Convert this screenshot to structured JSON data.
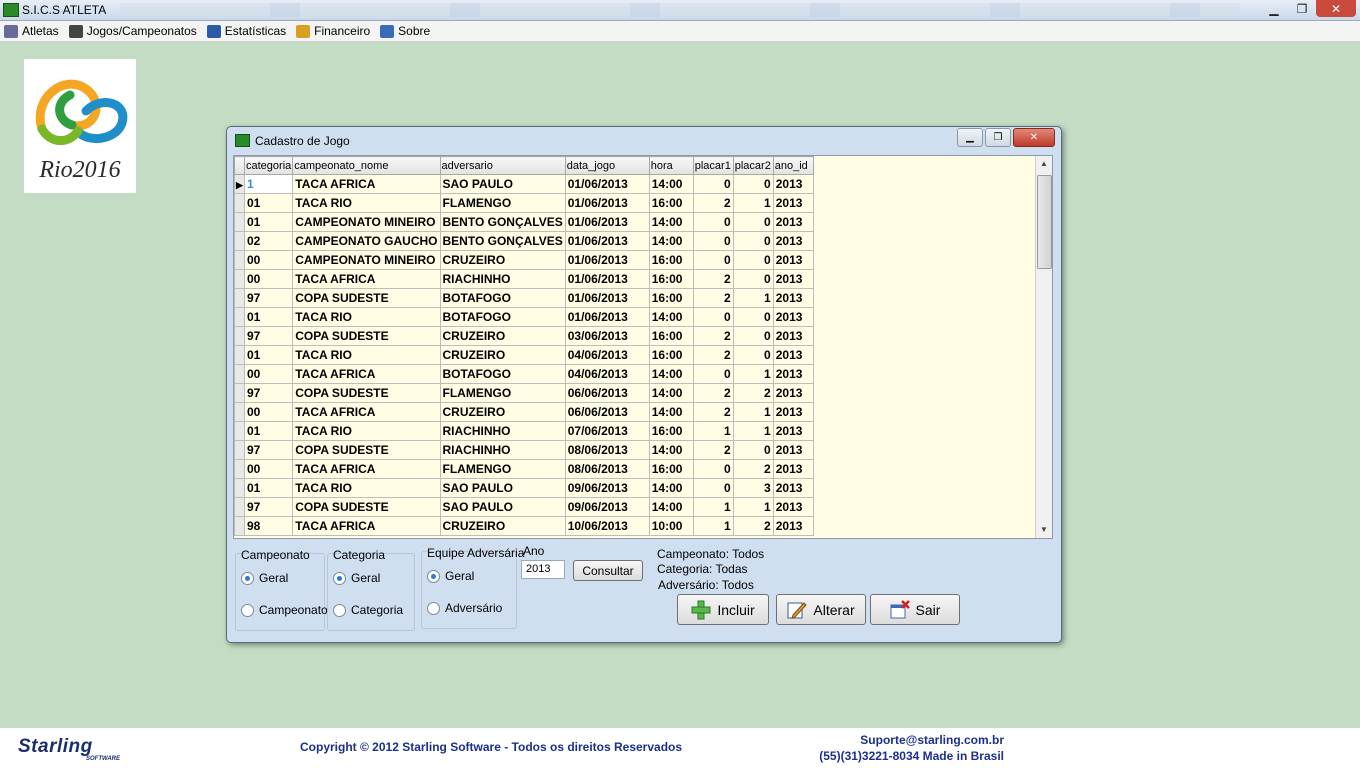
{
  "app": {
    "title": "S.I.C.S ATLETA"
  },
  "window_controls": {
    "minimize": "▁",
    "restore": "❐",
    "close": "✕"
  },
  "menu": {
    "items": [
      {
        "label": "Atletas",
        "icon": "user-icon",
        "color": "#6a6a9a"
      },
      {
        "label": "Jogos/Campeonatos",
        "icon": "soccer-ball-icon",
        "color": "#444444"
      },
      {
        "label": "Estatísticas",
        "icon": "chart-icon",
        "color": "#2a5aa8"
      },
      {
        "label": "Financeiro",
        "icon": "coins-icon",
        "color": "#d8a020"
      },
      {
        "label": "Sobre",
        "icon": "info-book-icon",
        "color": "#3a6ab8"
      }
    ]
  },
  "logo": {
    "text": "Rio2016"
  },
  "dialog": {
    "title": "Cadastro de Jogo",
    "controls": {
      "minimize": "▁",
      "restore": "❐",
      "close": "✕"
    },
    "grid": {
      "columns": [
        "categoria",
        "campeonato_nome",
        "adversario",
        "data_jogo",
        "hora",
        "placar1",
        "placar2",
        "ano_id"
      ],
      "rows": [
        [
          "1",
          "TACA AFRICA",
          "SAO PAULO",
          "01/06/2013",
          "14:00",
          "0",
          "0",
          "2013"
        ],
        [
          "01",
          "TACA RIO",
          "FLAMENGO",
          "01/06/2013",
          "16:00",
          "2",
          "1",
          "2013"
        ],
        [
          "01",
          "CAMPEONATO MINEIRO",
          "BENTO GONÇALVES",
          "01/06/2013",
          "14:00",
          "0",
          "0",
          "2013"
        ],
        [
          "02",
          "CAMPEONATO GAUCHO",
          "BENTO GONÇALVES",
          "01/06/2013",
          "14:00",
          "0",
          "0",
          "2013"
        ],
        [
          "00",
          "CAMPEONATO MINEIRO",
          "CRUZEIRO",
          "01/06/2013",
          "16:00",
          "0",
          "0",
          "2013"
        ],
        [
          "00",
          "TACA AFRICA",
          "RIACHINHO",
          "01/06/2013",
          "16:00",
          "2",
          "0",
          "2013"
        ],
        [
          "97",
          "COPA SUDESTE",
          "BOTAFOGO",
          "01/06/2013",
          "16:00",
          "2",
          "1",
          "2013"
        ],
        [
          "01",
          "TACA RIO",
          "BOTAFOGO",
          "01/06/2013",
          "14:00",
          "0",
          "0",
          "2013"
        ],
        [
          "97",
          "COPA SUDESTE",
          "CRUZEIRO",
          "03/06/2013",
          "16:00",
          "2",
          "0",
          "2013"
        ],
        [
          "01",
          "TACA RIO",
          "CRUZEIRO",
          "04/06/2013",
          "16:00",
          "2",
          "0",
          "2013"
        ],
        [
          "00",
          "TACA AFRICA",
          "BOTAFOGO",
          "04/06/2013",
          "14:00",
          "0",
          "1",
          "2013"
        ],
        [
          "97",
          "COPA SUDESTE",
          "FLAMENGO",
          "06/06/2013",
          "14:00",
          "2",
          "2",
          "2013"
        ],
        [
          "00",
          "TACA AFRICA",
          "CRUZEIRO",
          "06/06/2013",
          "14:00",
          "2",
          "1",
          "2013"
        ],
        [
          "01",
          "TACA RIO",
          "RIACHINHO",
          "07/06/2013",
          "16:00",
          "1",
          "1",
          "2013"
        ],
        [
          "97",
          "COPA SUDESTE",
          "RIACHINHO",
          "08/06/2013",
          "14:00",
          "2",
          "0",
          "2013"
        ],
        [
          "00",
          "TACA AFRICA",
          "FLAMENGO",
          "08/06/2013",
          "16:00",
          "0",
          "2",
          "2013"
        ],
        [
          "01",
          "TACA RIO",
          "SAO PAULO",
          "09/06/2013",
          "14:00",
          "0",
          "3",
          "2013"
        ],
        [
          "97",
          "COPA SUDESTE",
          "SAO PAULO",
          "09/06/2013",
          "14:00",
          "1",
          "1",
          "2013"
        ],
        [
          "98",
          "TACA AFRICA",
          "CRUZEIRO",
          "10/06/2013",
          "10:00",
          "1",
          "2",
          "2013"
        ]
      ]
    },
    "filters": {
      "campeonato": {
        "title": "Campeonato",
        "opt1": "Geral",
        "opt2": "Campeonato",
        "selected": "Geral"
      },
      "categoria": {
        "title": "Categoria",
        "opt1": "Geral",
        "opt2": "Categoria",
        "selected": "Geral"
      },
      "equipe": {
        "title": "Equipe Adversária",
        "opt1": "Geral",
        "opt2": "Adversário",
        "selected": "Geral"
      },
      "ano": {
        "label": "Ano",
        "value": "2013"
      },
      "consultar": "Consultar"
    },
    "summary": {
      "campeonato": "Campeonato: Todos",
      "categoria": "Categoria: Todas",
      "adversario": "Adversário: Todos"
    },
    "buttons": {
      "incluir": "Incluir",
      "alterar": "Alterar",
      "sair": "Sair"
    }
  },
  "footer": {
    "brand": "Starling",
    "brand_sub": "SOFTWARE",
    "copyright": "Copyright © 2012 Starling Software - Todos os direitos Reservados",
    "support": "Suporte@starling.com.br",
    "phone": "(55)(31)3221-8034 Made in Brasil"
  }
}
